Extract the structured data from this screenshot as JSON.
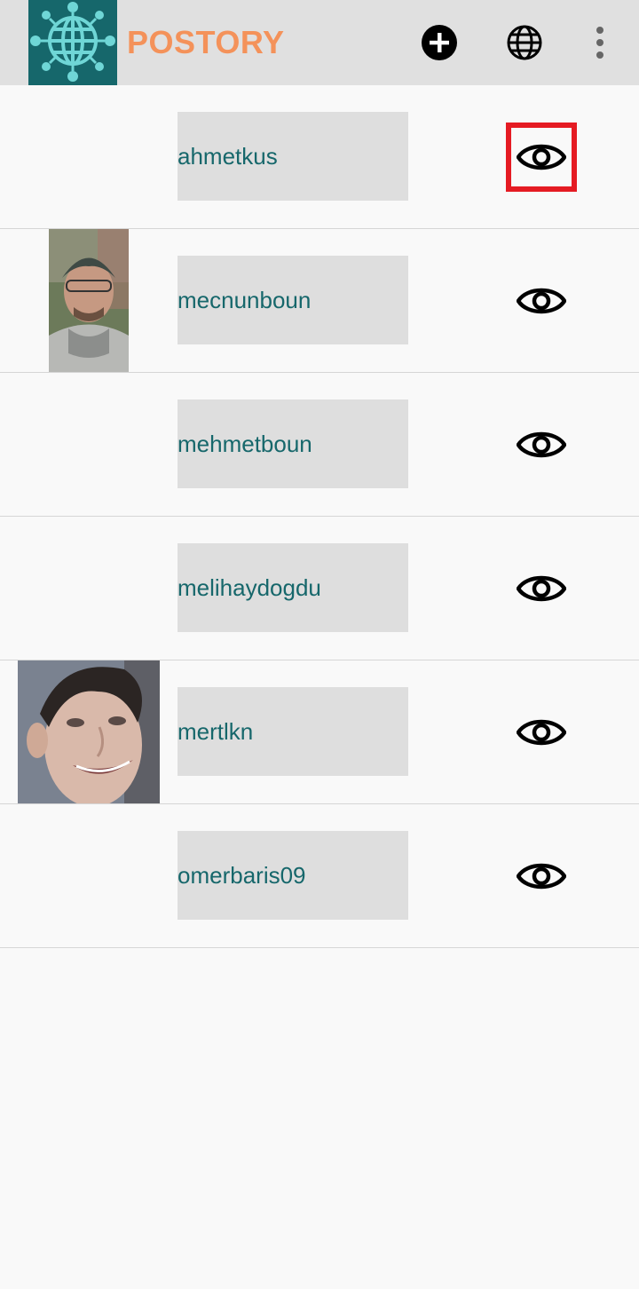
{
  "header": {
    "app_title": "POSTORY",
    "title_color": "#f4925a",
    "brand_color": "#16676b",
    "icons": [
      "globe-network-logo",
      "add-circle-icon",
      "globe-icon",
      "more-vertical-icon"
    ]
  },
  "users": [
    {
      "username": "ahmetkus",
      "has_photo": false,
      "highlighted": true
    },
    {
      "username": "mecnunboun",
      "has_photo": true,
      "highlighted": false
    },
    {
      "username": "mehmetboun",
      "has_photo": false,
      "highlighted": false
    },
    {
      "username": "melihaydogdu",
      "has_photo": false,
      "highlighted": false
    },
    {
      "username": "mertlkn",
      "has_photo": true,
      "highlighted": false
    },
    {
      "username": "omerbaris09",
      "has_photo": false,
      "highlighted": false
    }
  ],
  "row_action_icon": "eye-icon",
  "highlight_color": "#e51b23"
}
